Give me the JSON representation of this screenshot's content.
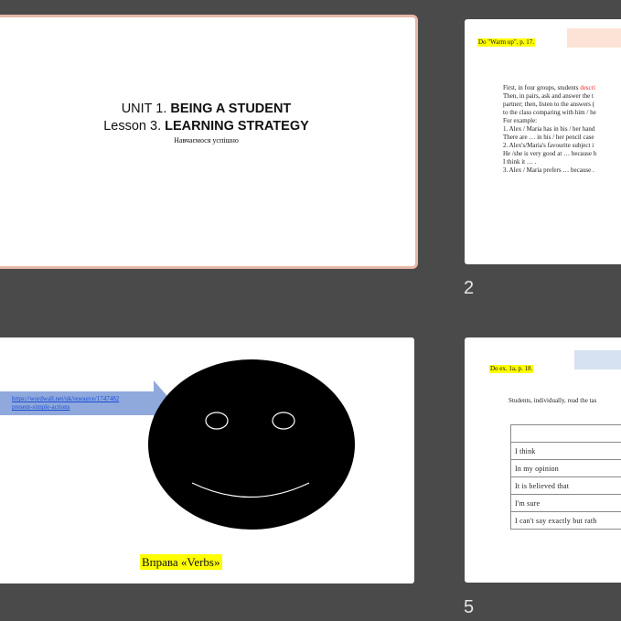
{
  "slides": [
    {
      "number": "",
      "line1_plain": "UNIT 1. ",
      "line1_bold": "BEING A STUDENT",
      "line2_plain": "Lesson 3. ",
      "line2_bold": "LEARNING STRATEGY",
      "subtitle": "Навчаємося успішно"
    },
    {
      "number": "2",
      "tag": "Do \"Warm up\", p. 17.",
      "body_lines": [
        {
          "text": "First, in four groups, students ",
          "red": "descri"
        },
        {
          "text": "Then, in pairs, ask and answer the t",
          "red": ""
        },
        {
          "text": "partner; then, listen to the answers (",
          "red": ""
        },
        {
          "text": "to the class comparing with him / he",
          "red": ""
        },
        {
          "text": "For example:",
          "red": ""
        },
        {
          "text": "1. Alex / Maria has in his / her hand",
          "red": ""
        },
        {
          "text": "There are … in his / her pencil case",
          "red": ""
        },
        {
          "text": "2. Alex's/Maria's favourite subject i",
          "red": ""
        },
        {
          "text": "He /she is very good at … because h",
          "red": ""
        },
        {
          "text": "I think it … .",
          "red": ""
        },
        {
          "text": "3. Alex / Maria prefers … because .",
          "red": ""
        }
      ]
    },
    {
      "number": "",
      "link_line1": "https://wordwall.net/uk/resource/1747482",
      "link_line2": "present-simple-actions",
      "caption": "Вправа «Verbs»"
    },
    {
      "number": "5",
      "tag": "Do ex. 1a, p. 18.",
      "instruction": "Students, individually, read the tas",
      "table_rows": [
        "",
        "I think",
        "In my opinion",
        "It is believed that",
        "I'm sure",
        "I can't say exactly but rath"
      ]
    }
  ],
  "colors": {
    "background": "#4a4a4a",
    "selected_border": "#e7b7a8",
    "highlight": "#ffff00",
    "arrow": "#8fa9dc",
    "link": "#1a4bd6"
  }
}
